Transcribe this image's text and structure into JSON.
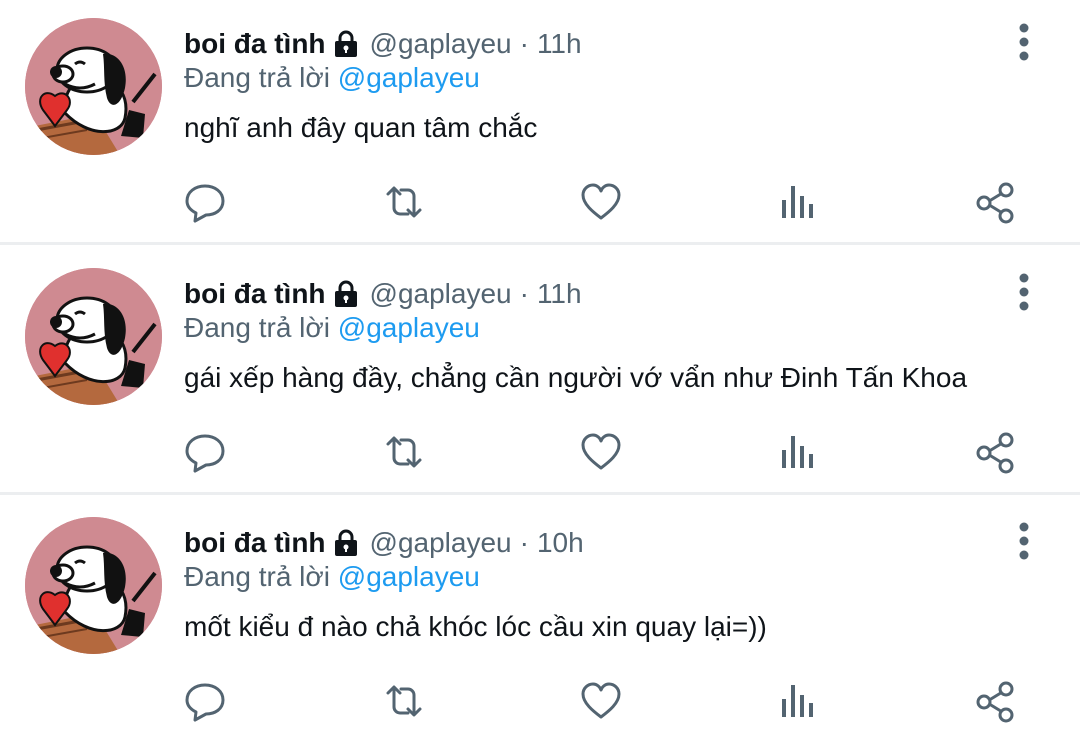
{
  "tweets": [
    {
      "display_name": "boi đa tình",
      "handle": "@gaplayeu",
      "separator": "·",
      "time": "11h",
      "reply_prefix": "Đang trả lời",
      "reply_to": "@gaplayeu",
      "text": "nghĩ anh đây quan tâm chắc"
    },
    {
      "display_name": "boi đa tình",
      "handle": "@gaplayeu",
      "separator": "·",
      "time": "11h",
      "reply_prefix": "Đang trả lời",
      "reply_to": "@gaplayeu",
      "text": "gái xếp hàng đầy, chẳng cần người vớ vẩn như Đinh Tấn Khoa"
    },
    {
      "display_name": "boi đa tình",
      "handle": "@gaplayeu",
      "separator": "·",
      "time": "10h",
      "reply_prefix": "Đang trả lời",
      "reply_to": "@gaplayeu",
      "text": "mốt kiểu đ nào chả khóc lóc cầu xin quay lại=))"
    }
  ],
  "icons": {
    "lock": "lock-icon",
    "more": "more-vertical-icon",
    "reply": "reply-icon",
    "retweet": "retweet-icon",
    "like": "heart-icon",
    "views": "views-bar-chart-icon",
    "share": "share-icon"
  },
  "colors": {
    "name": "#0f1419",
    "secondary_text": "#536471",
    "link": "#1d9bf0",
    "icon": "#536471",
    "divider": "#eceef0",
    "avatar_bg": "#cf8a91"
  }
}
